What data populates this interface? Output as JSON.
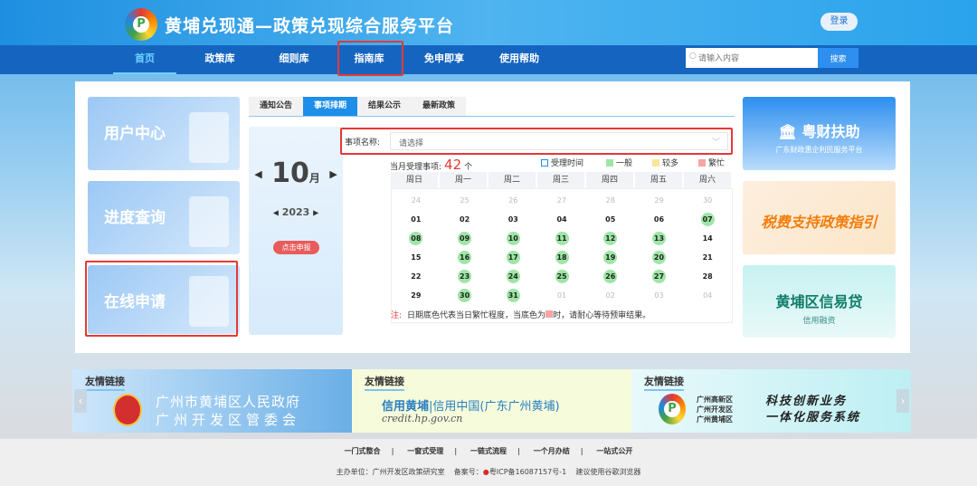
{
  "header": {
    "title": "黄埔兑现通—政策兑现综合服务平台",
    "login": "登录",
    "logo_text": "P"
  },
  "nav": {
    "items": [
      "首页",
      "政策库",
      "细则库",
      "指南库",
      "免申即享",
      "使用帮助"
    ],
    "search_placeholder": "请输入内容",
    "search_button": "搜索"
  },
  "left_cards": [
    "用户中心",
    "进度查询",
    "在线申请"
  ],
  "tabs": [
    "通知公告",
    "事项排期",
    "结果公示",
    "最新政策"
  ],
  "calendar": {
    "month": "10",
    "month_unit": "月",
    "year": "2023",
    "report_button": "点击申报",
    "select_label": "事项名称:",
    "select_placeholder": "请选择",
    "count_label": "当月受理事项:",
    "count": "42",
    "count_unit": "个",
    "legend": [
      "受理时间",
      "一般",
      "较多",
      "繁忙"
    ],
    "legend_colors": [
      "#1d8fe8",
      "#9ee6a6",
      "#fbe59a",
      "#f7a4a4"
    ],
    "weekdays": [
      "周日",
      "周一",
      "周二",
      "周三",
      "周四",
      "周五",
      "周六"
    ],
    "weeks": [
      [
        [
          "24",
          "other"
        ],
        [
          "25",
          "other"
        ],
        [
          "26",
          "other"
        ],
        [
          "27",
          "other"
        ],
        [
          "28",
          "other"
        ],
        [
          "29",
          "other"
        ],
        [
          "30",
          "other"
        ]
      ],
      [
        [
          "01",
          ""
        ],
        [
          "02",
          ""
        ],
        [
          "03",
          ""
        ],
        [
          "04",
          ""
        ],
        [
          "05",
          ""
        ],
        [
          "06",
          ""
        ],
        [
          "07",
          "green"
        ]
      ],
      [
        [
          "08",
          "green"
        ],
        [
          "09",
          "green"
        ],
        [
          "10",
          "green"
        ],
        [
          "11",
          "green"
        ],
        [
          "12",
          "green"
        ],
        [
          "13",
          "green"
        ],
        [
          "14",
          ""
        ]
      ],
      [
        [
          "15",
          ""
        ],
        [
          "16",
          "green"
        ],
        [
          "17",
          "green"
        ],
        [
          "18",
          "green"
        ],
        [
          "19",
          "green"
        ],
        [
          "20",
          "green"
        ],
        [
          "21",
          ""
        ]
      ],
      [
        [
          "22",
          ""
        ],
        [
          "23",
          "green"
        ],
        [
          "24",
          "green"
        ],
        [
          "25",
          "green"
        ],
        [
          "26",
          "green"
        ],
        [
          "27",
          "green"
        ],
        [
          "28",
          ""
        ]
      ],
      [
        [
          "29",
          ""
        ],
        [
          "30",
          "green"
        ],
        [
          "31",
          "green"
        ],
        [
          "01",
          "other"
        ],
        [
          "02",
          "other"
        ],
        [
          "03",
          "other"
        ],
        [
          "04",
          "other"
        ]
      ]
    ],
    "note_prefix": "注:",
    "note_a": "日期底色代表当日繁忙程度，当底色为",
    "note_b": "时，请耐心等待预审结果。"
  },
  "right_cards": {
    "c1_title": "粤财扶助",
    "c1_sub": "广东财政惠企利民服务平台",
    "c2_title": "税费支持政策指引",
    "c3_title": "黄埔区信易贷",
    "c3_sub": "信用融资"
  },
  "friend_links": {
    "tag": "友情链接",
    "f1_line1": "广州市黄埔区人民政府",
    "f1_line2": "广州开发区管委会",
    "f2_line1": "信用黄埔",
    "f2_line1b": "|信用中国(广东广州黄埔)",
    "f2_line2": "credit.hp.gov.cn",
    "f3_zones": [
      "广州高新区",
      "广州开发区",
      "广州黄埔区"
    ],
    "f3_line1": "科技创新业务",
    "f3_line2": "一体化服务系统",
    "prev": "‹",
    "next": "›"
  },
  "footer": {
    "links": [
      "一门式整合",
      "一窗式受理",
      "一链式流程",
      "一个月办结",
      "一站式公开"
    ],
    "sponsor": "主办单位：广州开发区政策研究室",
    "icp_label": "备案号：",
    "icp": "粤ICP备16087157号-1",
    "browser": "建议使用谷歌浏览器"
  }
}
